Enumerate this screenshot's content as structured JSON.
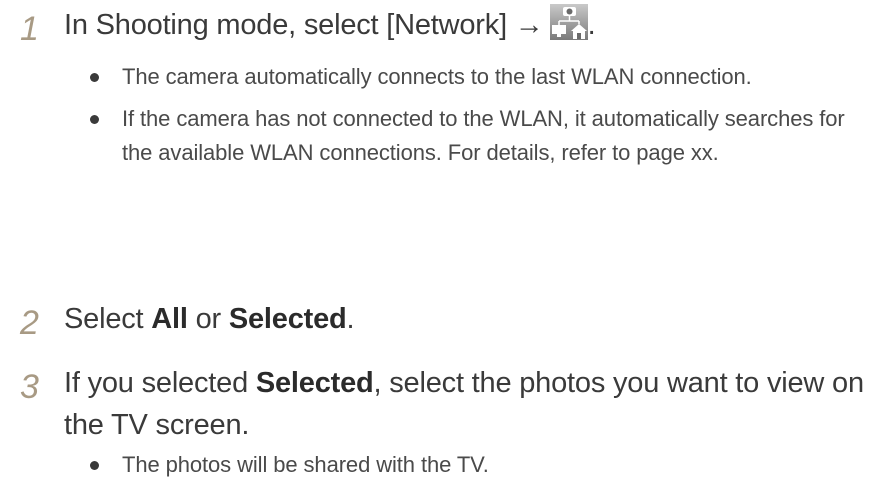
{
  "steps": [
    {
      "number": "1",
      "text_before_icon": "In Shooting mode, select [Network] →",
      "text_after_icon": ".",
      "icon": "network-camera-home-icon",
      "bullets": [
        "The camera automatically connects to the last WLAN connection.",
        "If the camera has not connected to the WLAN, it automatically searches for the available WLAN connections. For details, refer to page xx."
      ]
    },
    {
      "number": "2",
      "pre": "Select ",
      "bold1": "All",
      "mid": " or ",
      "bold2": "Selected",
      "post": "."
    },
    {
      "number": "3",
      "pre": "If you selected ",
      "bold1": "Selected",
      "post": ", select the photos you want to view on the TV screen.",
      "bullets": [
        "The photos will be shared with the TV."
      ]
    }
  ],
  "colors": {
    "step_number": "#a89a84",
    "text": "#3a3a3a"
  }
}
